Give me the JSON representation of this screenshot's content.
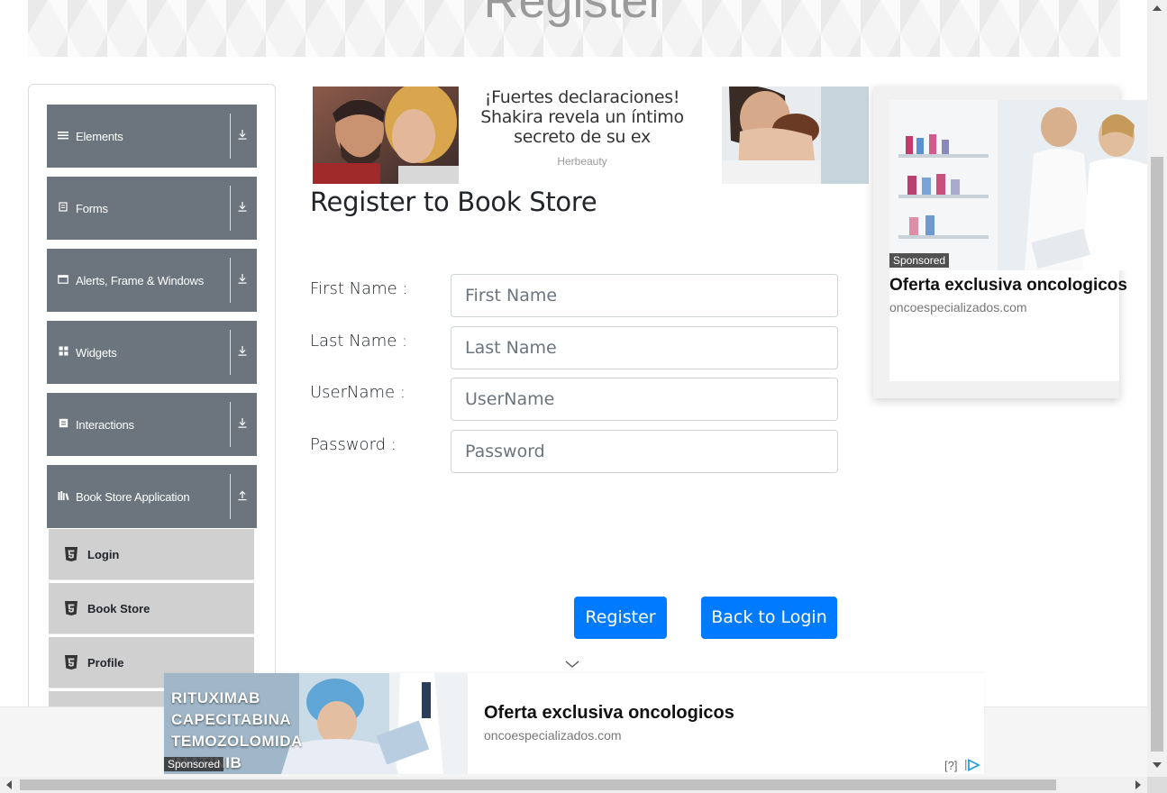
{
  "header": {
    "title": "Register"
  },
  "sidebar": {
    "groups": [
      {
        "label": "Elements",
        "icon": "hamburger-icon",
        "expanded": false
      },
      {
        "label": "Forms",
        "icon": "form-icon",
        "expanded": false
      },
      {
        "label": "Alerts, Frame & Windows",
        "icon": "window-icon",
        "expanded": false
      },
      {
        "label": "Widgets",
        "icon": "widgets-icon",
        "expanded": false
      },
      {
        "label": "Interactions",
        "icon": "interaction-icon",
        "expanded": false
      },
      {
        "label": "Book Store Application",
        "icon": "books-icon",
        "expanded": true
      }
    ],
    "book_store_items": [
      {
        "label": "Login",
        "icon": "html5-icon"
      },
      {
        "label": "Book Store",
        "icon": "html5-icon"
      },
      {
        "label": "Profile",
        "icon": "html5-icon"
      }
    ]
  },
  "top_ad": {
    "headline": "¡Fuertes declaraciones! Shakira revela un íntimo secreto de su ex",
    "source": "Herbeauty"
  },
  "form": {
    "title": "Register to Book Store",
    "fields": [
      {
        "label": "First Name :",
        "placeholder": "First Name"
      },
      {
        "label": "Last Name :",
        "placeholder": "Last Name"
      },
      {
        "label": "UserName :",
        "placeholder": "UserName"
      },
      {
        "label": "Password :",
        "placeholder": "Password"
      }
    ],
    "register_label": "Register",
    "back_label": "Back to Login"
  },
  "side_ad": {
    "sponsored": "Sponsored",
    "title": "Oferta exclusiva oncologicos",
    "domain": "oncoespecializados.com"
  },
  "bottom_ad": {
    "drugs": [
      "RITUXIMAB",
      "CAPECITABINA",
      "TEMOZOLOMIDA",
      "IMATINIB"
    ],
    "sponsored": "Sponsored",
    "title": "Oferta exclusiva oncologicos",
    "domain": "oncoespecializados.com",
    "adchoices": "[?]"
  },
  "colors": {
    "primary": "#007bff",
    "sidebar_header": "#6c757d",
    "sidebar_item": "#d0d0d0"
  }
}
